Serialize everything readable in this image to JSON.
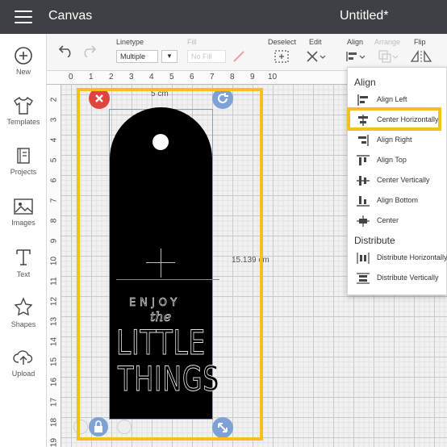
{
  "topbar": {
    "app_title": "Canvas",
    "doc_title": "Untitled*"
  },
  "sidebar": {
    "items": [
      {
        "label": "New",
        "icon": "plus-circle-icon"
      },
      {
        "label": "Templates",
        "icon": "shirt-icon"
      },
      {
        "label": "Projects",
        "icon": "projects-icon"
      },
      {
        "label": "Images",
        "icon": "image-icon"
      },
      {
        "label": "Text",
        "icon": "text-icon"
      },
      {
        "label": "Shapes",
        "icon": "shapes-icon"
      },
      {
        "label": "Upload",
        "icon": "upload-icon"
      }
    ]
  },
  "toolbar": {
    "linetype_label": "Linetype",
    "linetype_value": "Multiple",
    "fill_label": "Fill",
    "fill_value": "No Fill",
    "deselect_label": "Deselect",
    "edit_label": "Edit",
    "align_label": "Align",
    "arrange_label": "Arrange",
    "flip_label": "Flip"
  },
  "ruler": {
    "h_ticks": [
      "0",
      "1",
      "2",
      "3",
      "4",
      "5",
      "6",
      "7",
      "8",
      "9",
      "10"
    ],
    "v_ticks": [
      "2",
      "3",
      "4",
      "5",
      "6",
      "7",
      "8",
      "9",
      "10",
      "11",
      "12",
      "13",
      "14",
      "15",
      "16",
      "17",
      "18",
      "19"
    ]
  },
  "canvas": {
    "width_label": "5 cm",
    "height_label": "15.139 cm",
    "art": {
      "line1": "ENJOY",
      "line2": "the",
      "line3": "LITTLE",
      "line4": "THINGS"
    }
  },
  "align_menu": {
    "title": "Align",
    "items": [
      {
        "label": "Align Left",
        "icon": "align-left-icon"
      },
      {
        "label": "Center Horizontally",
        "icon": "center-horizontally-icon"
      },
      {
        "label": "Align Right",
        "icon": "align-right-icon"
      },
      {
        "label": "Align Top",
        "icon": "align-top-icon"
      },
      {
        "label": "Center Vertically",
        "icon": "center-vertically-icon"
      },
      {
        "label": "Align Bottom",
        "icon": "align-bottom-icon"
      },
      {
        "label": "Center",
        "icon": "center-icon"
      }
    ],
    "distribute_title": "Distribute",
    "distribute_items": [
      {
        "label": "Distribute Horizontally",
        "icon": "distribute-horizontally-icon"
      },
      {
        "label": "Distribute Vertically",
        "icon": "distribute-vertically-icon"
      }
    ]
  },
  "colors": {
    "highlight": "#f6c01a",
    "topbar": "#3d4146",
    "delete_handle": "#e0443f",
    "handle": "#7fa2d6"
  }
}
